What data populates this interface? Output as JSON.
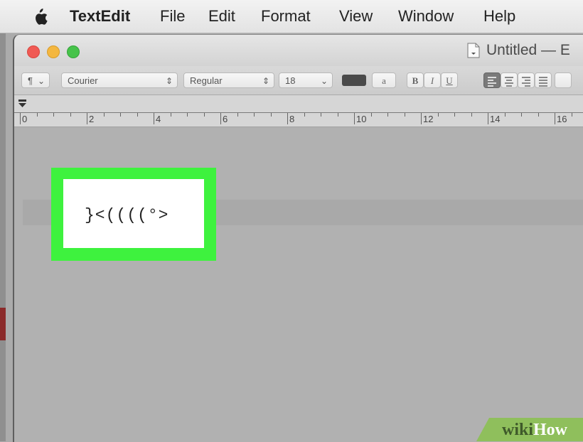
{
  "menubar": {
    "app_name": "TextEdit",
    "items": [
      "File",
      "Edit",
      "Format",
      "View",
      "Window",
      "Help"
    ]
  },
  "window": {
    "title": "Untitled — E",
    "traffic_colors": {
      "close": "#f05a54",
      "minimize": "#f4b740",
      "maximize": "#46c34a"
    }
  },
  "formatbar": {
    "paragraph_style": "¶",
    "font_family": "Courier",
    "font_style": "Regular",
    "font_size": "18",
    "text_color": "#4a4a4a",
    "background_color_label": "a",
    "bold_label": "B",
    "italic_label": "I",
    "underline_label": "U",
    "alignment_selected": "left"
  },
  "ruler": {
    "labels": [
      "0",
      "2",
      "4",
      "6",
      "8",
      "10",
      "12",
      "14",
      "16"
    ]
  },
  "document": {
    "text": "}<((((°>",
    "highlight_color": "#3ef23e"
  },
  "watermark": {
    "wiki": "wiki",
    "how": "How"
  }
}
